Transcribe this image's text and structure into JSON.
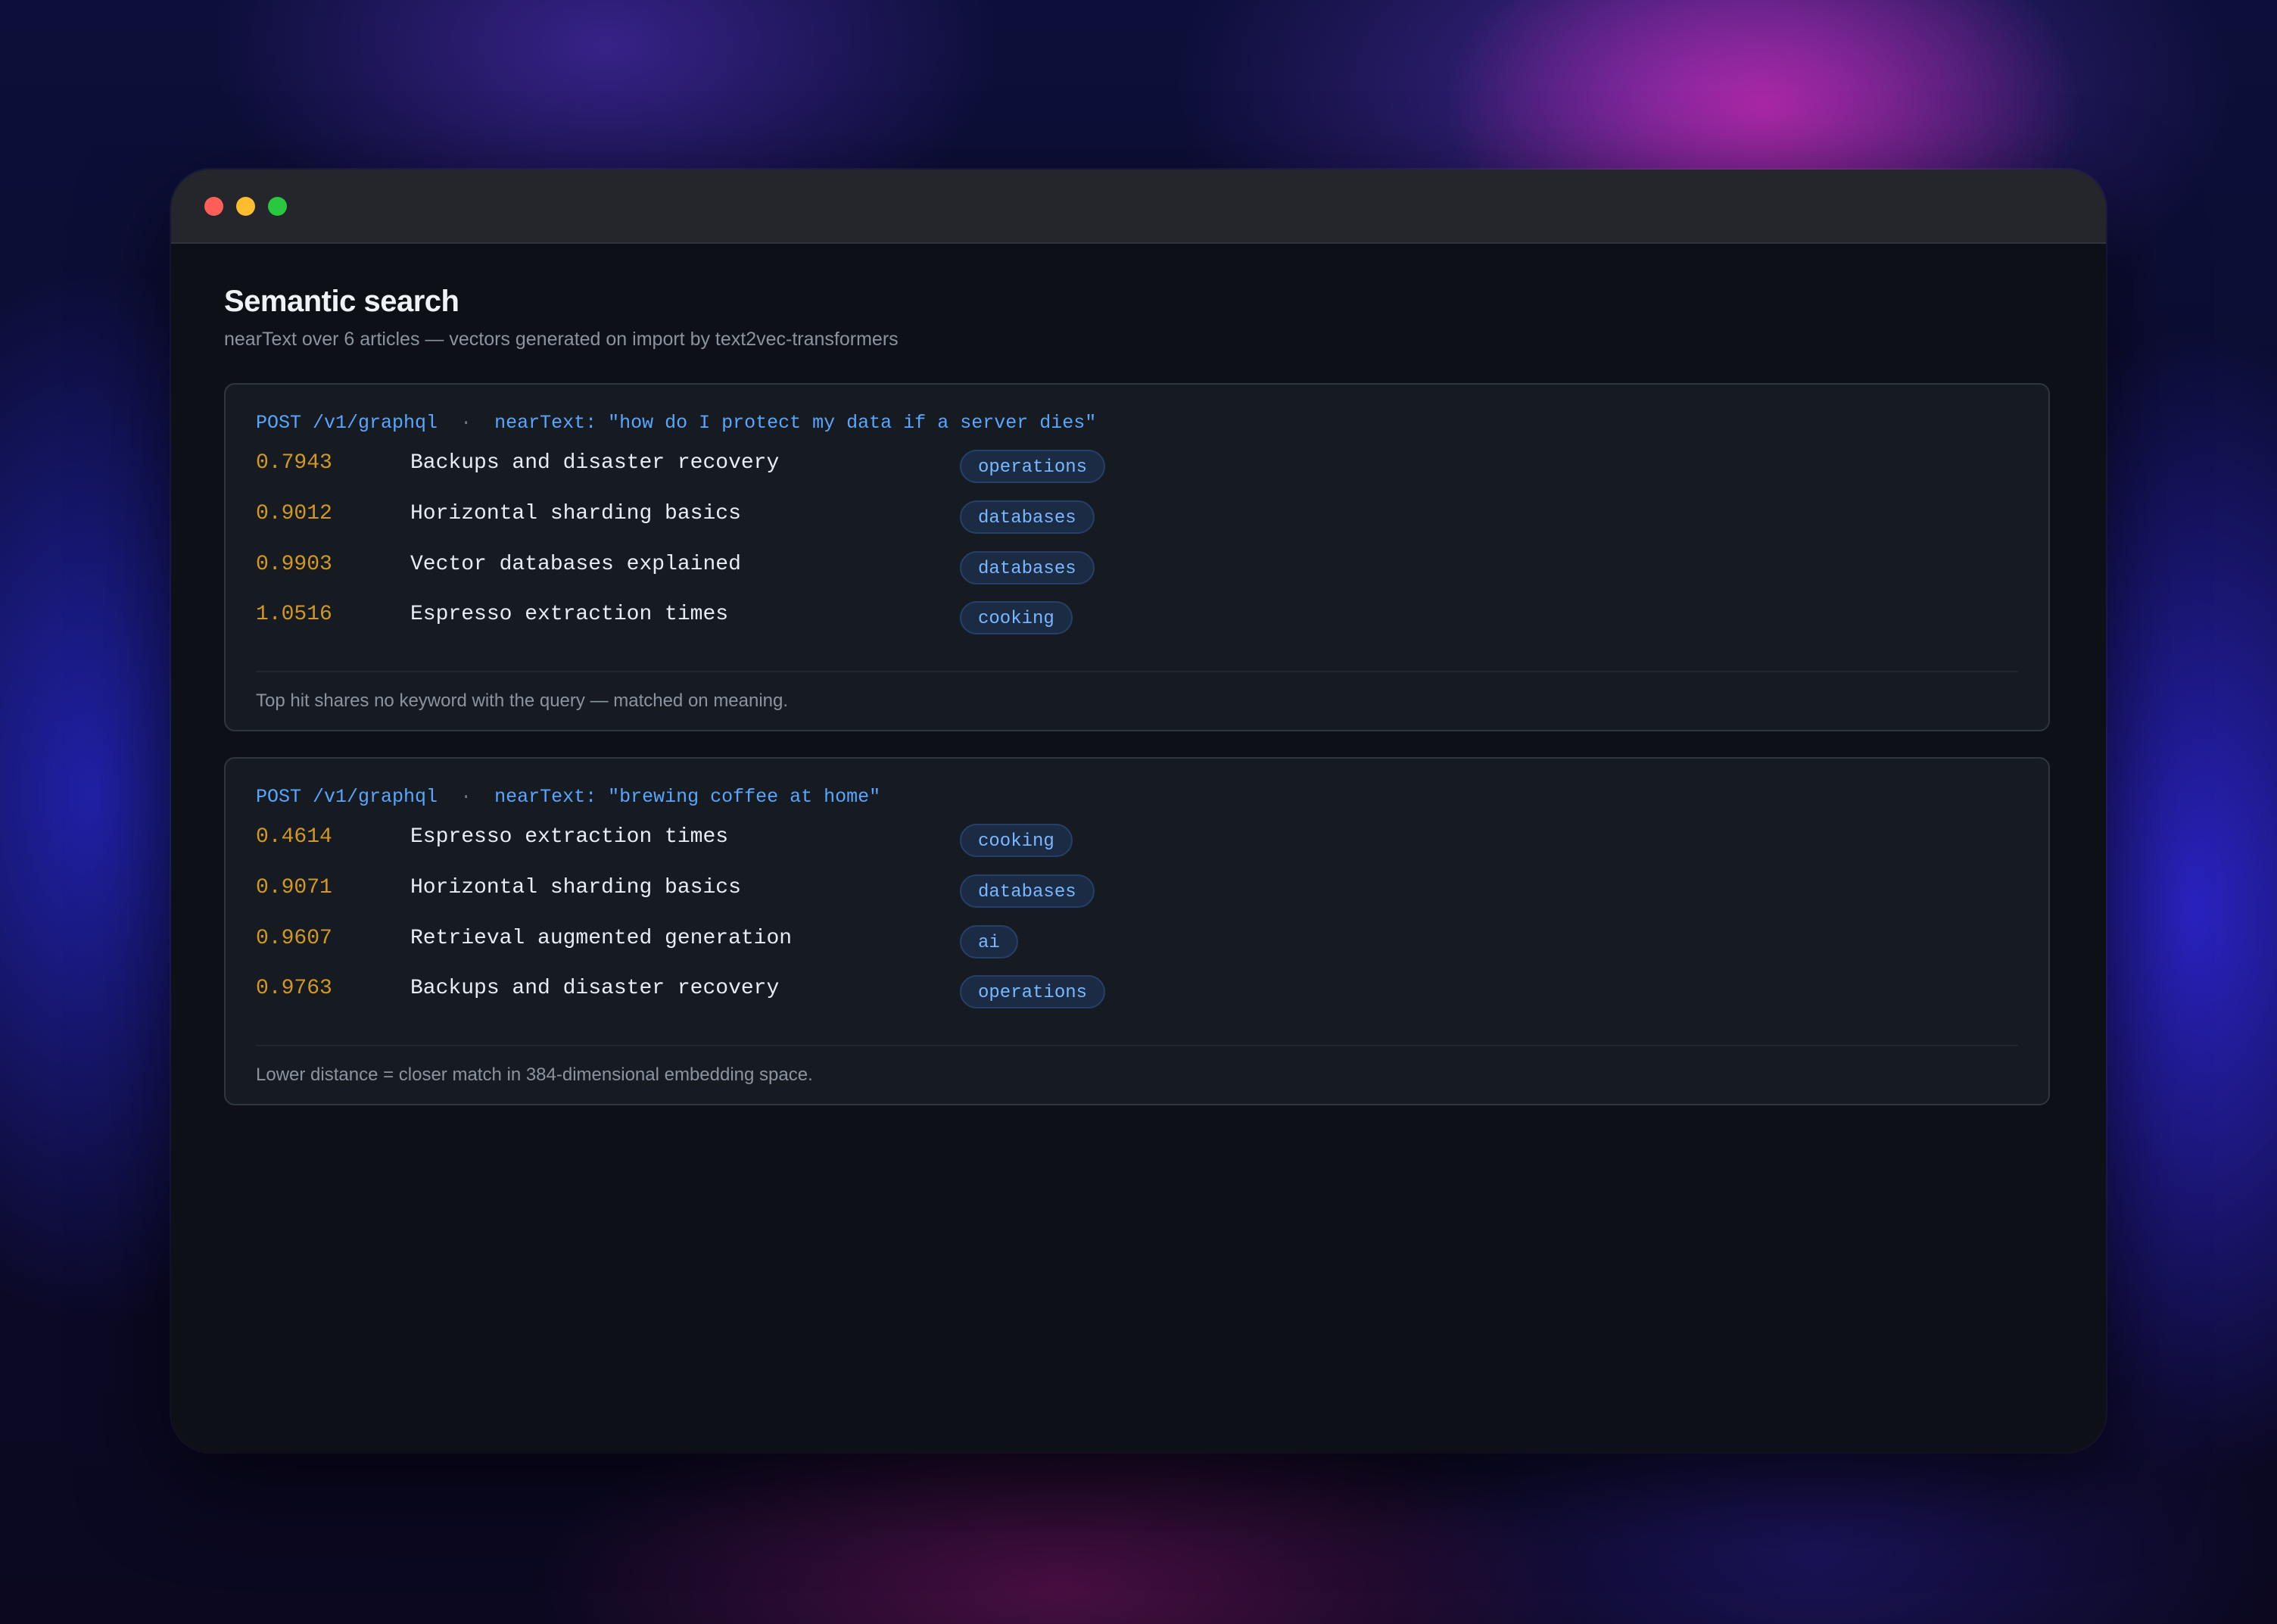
{
  "page": {
    "title": "Semantic search",
    "subtitle": "nearText over 6 articles — vectors generated on import by text2vec-transformers"
  },
  "queries": [
    {
      "method": "POST /v1/graphql",
      "separator": "·",
      "query": "nearText: \"how do I protect my data if a server dies\"",
      "results": [
        {
          "score": "0.7943",
          "title": "Backups and disaster recovery",
          "tag": "operations"
        },
        {
          "score": "0.9012",
          "title": "Horizontal sharding basics",
          "tag": "databases"
        },
        {
          "score": "0.9903",
          "title": "Vector databases explained",
          "tag": "databases"
        },
        {
          "score": "1.0516",
          "title": "Espresso extraction times",
          "tag": "cooking"
        }
      ],
      "footnote": "Top hit shares no keyword with the query — matched on meaning."
    },
    {
      "method": "POST /v1/graphql",
      "separator": "·",
      "query": "nearText: \"brewing coffee at home\"",
      "results": [
        {
          "score": "0.4614",
          "title": "Espresso extraction times",
          "tag": "cooking"
        },
        {
          "score": "0.9071",
          "title": "Horizontal sharding basics",
          "tag": "databases"
        },
        {
          "score": "0.9607",
          "title": "Retrieval augmented generation",
          "tag": "ai"
        },
        {
          "score": "0.9763",
          "title": "Backups and disaster recovery",
          "tag": "operations"
        }
      ],
      "footnote": "Lower distance = closer match in 384-dimensional embedding space."
    }
  ],
  "colors": {
    "score": "#d29922",
    "request": "#58a6ff",
    "tag_text": "#79b8ff",
    "window_bg": "#0d1117",
    "card_bg": "#161b22"
  }
}
